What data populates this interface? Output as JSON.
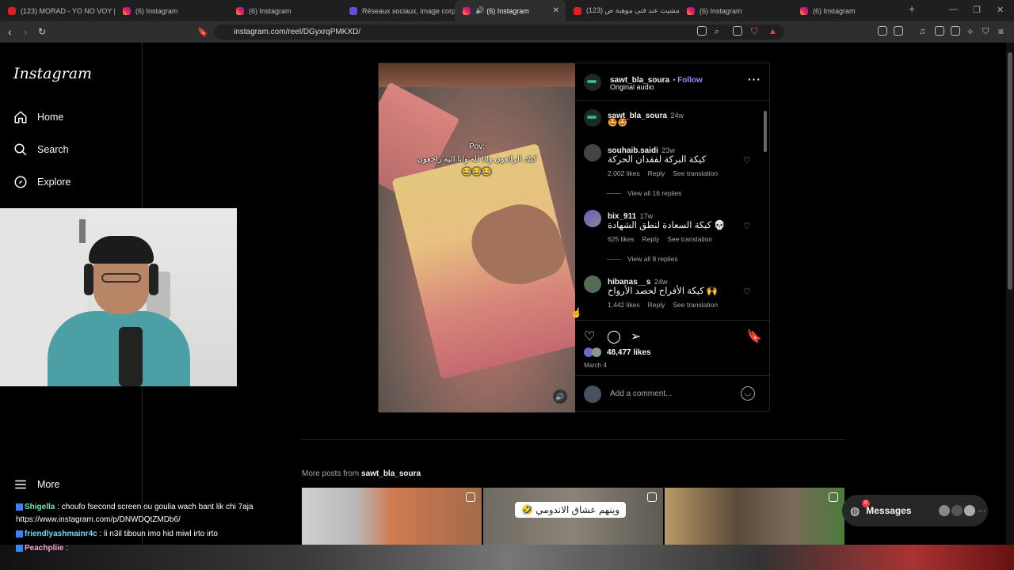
{
  "browser": {
    "tabs": [
      {
        "title": "(123) MORAD - YO NO VOY [V",
        "icon": "youtube"
      },
      {
        "title": "(6) Instagram",
        "icon": "instagram"
      },
      {
        "title": "(6) Instagram",
        "icon": "instagram"
      },
      {
        "title": "Réseaux sociaux, image corpo",
        "icon": "site"
      },
      {
        "title": "(6) Instagram",
        "icon": "instagram",
        "active": true
      },
      {
        "title": "(123) مشيت عند فتى موهبة ض",
        "icon": "youtube"
      },
      {
        "title": "(6) Instagram",
        "icon": "instagram"
      },
      {
        "title": "(6) Instagram",
        "icon": "instagram"
      }
    ],
    "url": "instagram.com/reel/DGyxrqPMKXD/"
  },
  "sidebar": {
    "logo": "Instagram",
    "items": [
      {
        "label": "Home",
        "icon": "home-icon"
      },
      {
        "label": "Search",
        "icon": "search-icon"
      },
      {
        "label": "Explore",
        "icon": "compass-icon"
      }
    ],
    "more_label": "More"
  },
  "video": {
    "caption_line1": "Pov:",
    "caption_line2": "كيك الرائعون وانا لله وانا اليه راجعون",
    "caption_emoji": "😂😂😂"
  },
  "post": {
    "author": "sawt_bla_soura",
    "follow": "Follow",
    "audio": "Original audio",
    "caption_author": "sawt_bla_soura",
    "caption_age": "24w",
    "caption_text": "🤩🤩",
    "comments": [
      {
        "user": "souhaib.saidi",
        "age": "23w",
        "text": "كيكة البركة لفقدان الحركة",
        "likes": "2,002 likes",
        "reply": "Reply",
        "translate": "See translation",
        "replies": "View all 16 replies"
      },
      {
        "user": "bix_911",
        "age": "17w",
        "text": "💀 كيكة السعادة لنطق الشهادة",
        "likes": "625 likes",
        "reply": "Reply",
        "translate": "See translation",
        "replies": "View all 8 replies"
      },
      {
        "user": "hibanas__s",
        "age": "24w",
        "text": "🙌 كيكة الأفراح لحصد الأرواح",
        "likes": "1,442 likes",
        "reply": "Reply",
        "translate": "See translation"
      }
    ],
    "likes": "48,477 likes",
    "date": "March 4",
    "add_comment_placeholder": "Add a comment..."
  },
  "more_posts": {
    "prefix": "More posts from",
    "author": "sawt_bla_soura",
    "thumb_text": "وينهم عشاق الاندومي 🤣"
  },
  "messages": {
    "label": "Messages",
    "badge": "6"
  },
  "chat": [
    {
      "user": "Shigella",
      "msg": ": choufo fsecond screen ou goulia wach bant lik chi 7aja",
      "color": "#6ee7b7"
    },
    {
      "user": "",
      "msg": "https://www.instagram.com/p/DNWDQtZMDb6/",
      "color": "#ffffff"
    },
    {
      "user": "friendlyashmainr4c",
      "msg": ": li n3il tiboun imo hid miwl irto irto",
      "color": "#7dd3fc"
    },
    {
      "user": "Peachpliie",
      "msg": ":",
      "color": "#f9a8d4"
    }
  ]
}
